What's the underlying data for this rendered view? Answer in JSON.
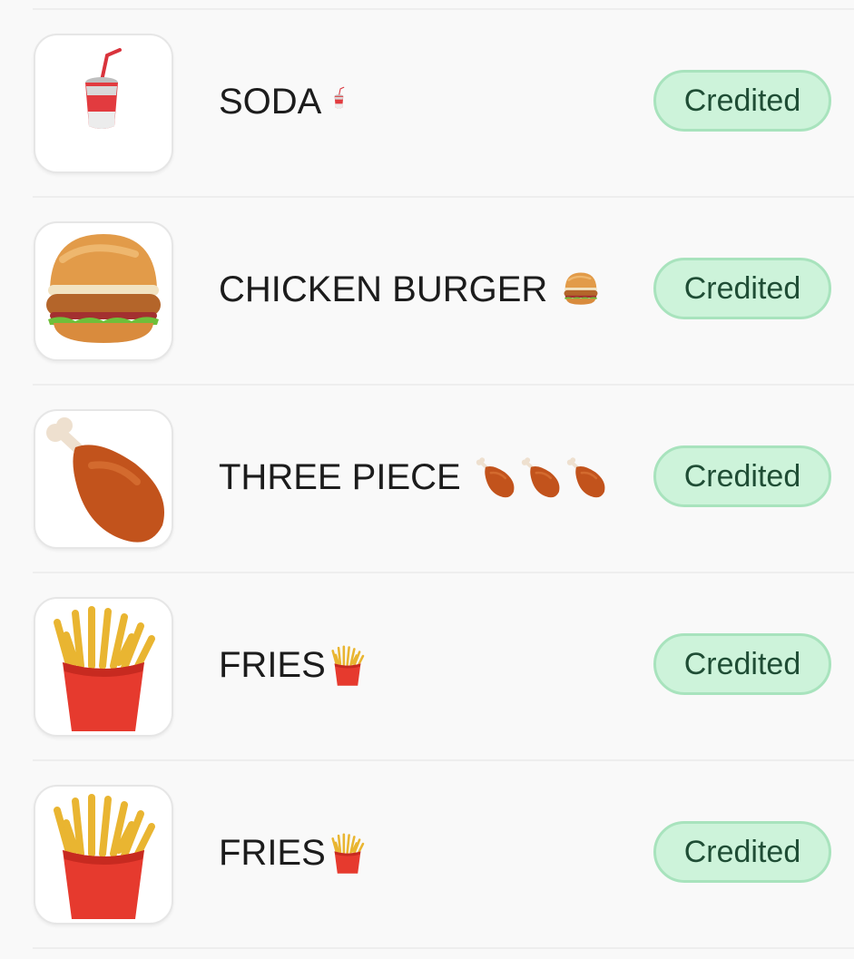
{
  "items": [
    {
      "title": "SODA",
      "icon": "soda-cup-icon",
      "status": "Credited"
    },
    {
      "title": "CHICKEN BURGER",
      "icon": "hamburger-icon",
      "status": "Credited"
    },
    {
      "title": "THREE PIECE",
      "icon": "chicken-drumstick-icon",
      "status": "Credited"
    },
    {
      "title": "FRIES",
      "icon": "french-fries-icon",
      "status": "Credited"
    },
    {
      "title": "FRIES",
      "icon": "french-fries-icon",
      "status": "Credited"
    }
  ],
  "colors": {
    "badge_bg": "#cdf3da",
    "badge_border": "#a8e3bd",
    "badge_text": "#1f4d35",
    "title_text": "#1c1c1c"
  }
}
